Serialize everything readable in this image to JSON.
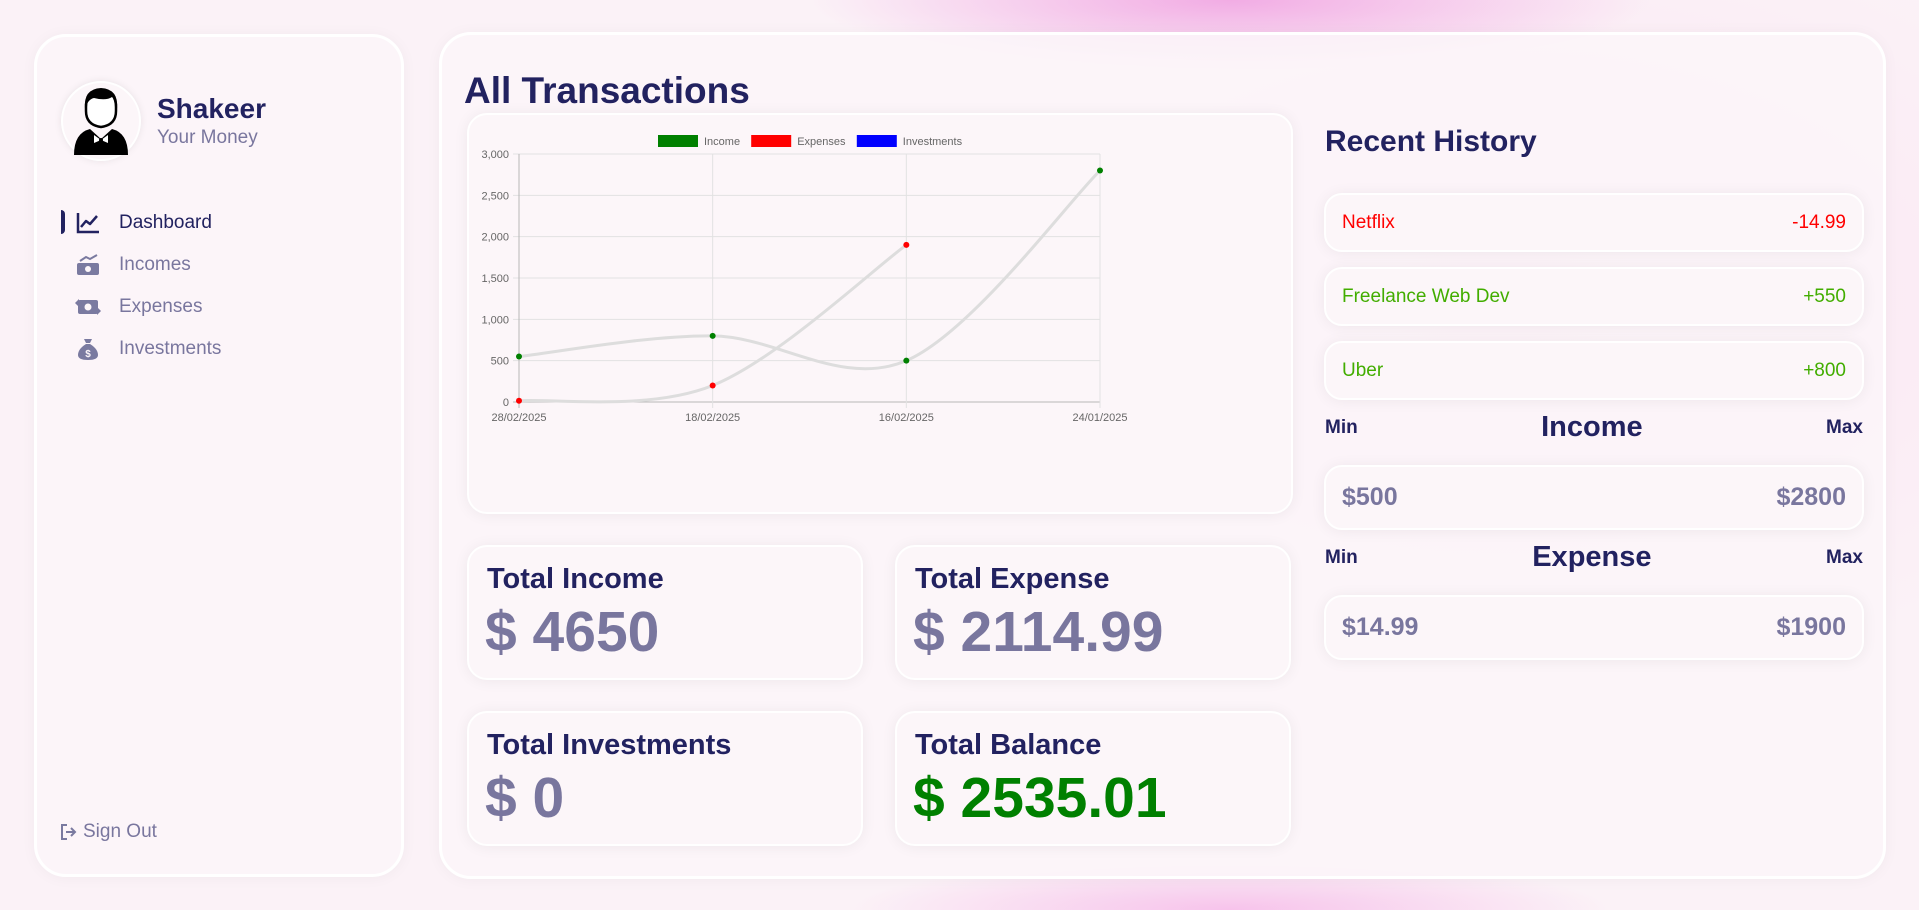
{
  "profile": {
    "name": "Shakeer",
    "subtitle": "Your Money"
  },
  "menu": [
    {
      "label": "Dashboard",
      "icon": "chart-line-icon",
      "active": true
    },
    {
      "label": "Incomes",
      "icon": "money-trend-icon",
      "active": false
    },
    {
      "label": "Expenses",
      "icon": "money-exchange-icon",
      "active": false
    },
    {
      "label": "Investments",
      "icon": "money-bag-icon",
      "active": false
    }
  ],
  "signout": {
    "label": "Sign Out",
    "icon": "sign-out-icon"
  },
  "page_title": "All Transactions",
  "chart_data": {
    "type": "line",
    "x": [
      "28/02/2025",
      "18/02/2025",
      "16/02/2025",
      "24/01/2025"
    ],
    "series": [
      {
        "name": "Income",
        "color": "#008000",
        "values": [
          550,
          800,
          500,
          2800
        ]
      },
      {
        "name": "Expenses",
        "color": "#ff0000",
        "values": [
          14.99,
          200,
          1900,
          null
        ]
      },
      {
        "name": "Investments",
        "color": "#0000ff",
        "values": []
      }
    ],
    "yticks": [
      "0",
      "500",
      "1,000",
      "1,500",
      "2,000",
      "2,500",
      "3,000"
    ],
    "ylim": [
      0,
      3000
    ],
    "line_color": "#dddddd",
    "legend_position": "top",
    "grid": true
  },
  "stats": {
    "income": {
      "label": "Total Income",
      "value": "$ 4650"
    },
    "expense": {
      "label": "Total Expense",
      "value": "$ 2114.99"
    },
    "investments": {
      "label": "Total Investments",
      "value": "$ 0"
    },
    "balance": {
      "label": "Total Balance",
      "value": "$ 2535.01",
      "color": "#008000"
    }
  },
  "history": {
    "title": "Recent History",
    "items": [
      {
        "title": "Netflix",
        "amount": "-14.99",
        "type": "expense",
        "color": "#ff0000"
      },
      {
        "title": "Freelance Web Dev",
        "amount": "+550",
        "type": "income",
        "color": "#42ad00"
      },
      {
        "title": "Uber",
        "amount": "+800",
        "type": "income",
        "color": "#42ad00"
      }
    ]
  },
  "income_range": {
    "title": "Income",
    "min_label": "Min",
    "max_label": "Max",
    "min": "$500",
    "max": "$2800"
  },
  "expense_range": {
    "title": "Expense",
    "min_label": "Min",
    "max_label": "Max",
    "min": "$14.99",
    "max": "$1900"
  }
}
